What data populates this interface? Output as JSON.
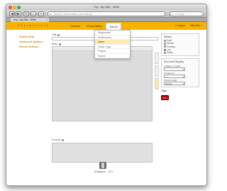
{
  "browser": {
    "window_title": "Txp - My Site - Write",
    "url_placeholder": "Search bookmarks and history",
    "search_placeholder": "Google",
    "tab_label": "Txp - My Site - Write",
    "nav_back": "◀",
    "nav_forward": "▶",
    "reload": "↻",
    "home": "⌂",
    "bookmark": "+"
  },
  "app": {
    "site_title": "T e x t p a t t e r n",
    "nav": [
      "Content",
      "Presentation",
      "Admin"
    ],
    "active_nav_index": 2,
    "header_right": [
      "» Logout",
      "View Site »"
    ],
    "dropdown_items": [
      "Diagnostics",
      "Preferences",
      "Users",
      "Visitor Logs",
      "Plugins",
      "Import"
    ],
    "highlight_index": 2,
    "left_links": [
      "Textile Help",
      "Advanced Options",
      "Recent Articles"
    ],
    "title_label": "Title",
    "body_label": "Body",
    "excerpt_label": "Excerpt",
    "status": {
      "title": "Status",
      "options": [
        "Draft",
        "Hidden",
        "Pending",
        "Live",
        "Sticky"
      ],
      "selected_index": 3
    },
    "sort": {
      "title": "Sort and Display",
      "category1_label": "Category 1",
      "category2_label": "Category 2",
      "section_label": "Section",
      "edit_label": "[edit]",
      "section_value": "articles"
    },
    "tags_label": "Tags",
    "save_label": "Save",
    "footer_text": "Textpattern · 4.2.0"
  },
  "colors": {
    "header": "#f7b300",
    "link": "#c7870c",
    "save": "#b30000"
  }
}
